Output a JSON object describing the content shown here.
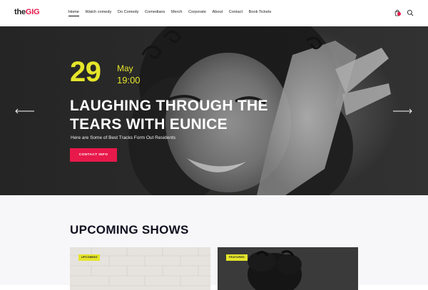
{
  "header": {
    "logo_the": "the",
    "logo_gig": "GIG",
    "nav": [
      {
        "label": "Home",
        "active": true
      },
      {
        "label": "Watch comedy"
      },
      {
        "label": "Do Comedy"
      },
      {
        "label": "Comedians"
      },
      {
        "label": "Merch"
      },
      {
        "label": "Corporate"
      },
      {
        "label": "About"
      },
      {
        "label": "Contact"
      },
      {
        "label": "Book Tickets"
      }
    ],
    "icons": {
      "cart": "shopping-bag-icon",
      "search": "search-icon"
    }
  },
  "hero": {
    "day": "29",
    "month": "May",
    "time": "19:00",
    "title": "LAUGHING THROUGH THE TEARS WITH EUNICE",
    "subtitle": "Here are Some of Best Tracks Form Out Residents",
    "button": "CONTACT INFO",
    "arrows": {
      "prev": "arrow-left-icon",
      "next": "arrow-right-icon"
    }
  },
  "upcoming": {
    "title": "UPCOMING SHOWS",
    "cards": [
      {
        "badge": "UPCOMING"
      },
      {
        "badge": "FEATURED"
      }
    ]
  },
  "colors": {
    "accent": "#e8194b",
    "highlight": "#e5e52a",
    "dark": "#101020"
  }
}
